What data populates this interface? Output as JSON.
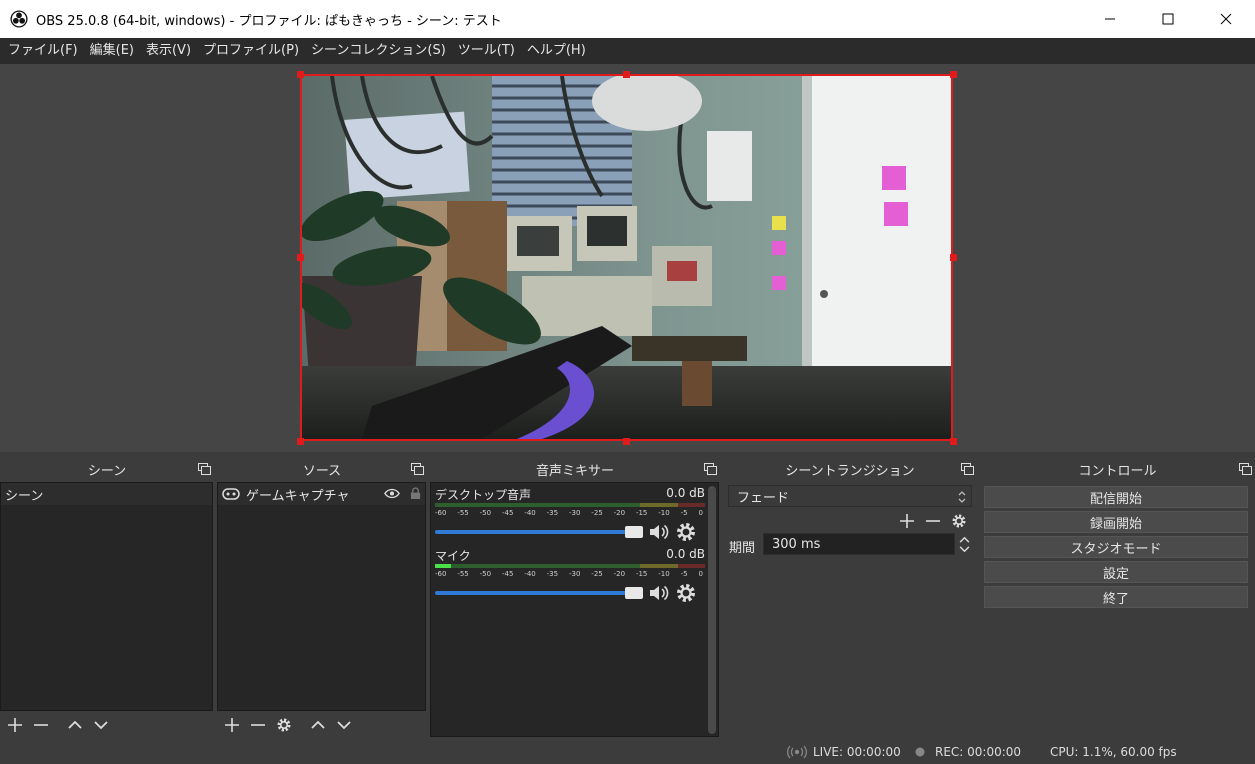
{
  "window": {
    "title": "OBS 25.0.8 (64-bit, windows) - プロファイル: ぱもきゃっち - シーン: テスト"
  },
  "menu": [
    "ファイル(F)",
    "編集(E)",
    "表示(V)",
    "プロファイル(P)",
    "シーンコレクション(S)",
    "ツール(T)",
    "ヘルプ(H)"
  ],
  "docks": {
    "scenes": {
      "title": "シーン",
      "items": [
        "シーン"
      ]
    },
    "sources": {
      "title": "ソース",
      "items": [
        "ゲームキャプチャ"
      ]
    },
    "mixer": {
      "title": "音声ミキサー",
      "ticks": [
        "-60",
        "-55",
        "-50",
        "-45",
        "-40",
        "-35",
        "-30",
        "-25",
        "-20",
        "-15",
        "-10",
        "-5",
        "0"
      ],
      "channels": [
        {
          "name": "デスクトップ音声",
          "db": "0.0 dB",
          "volume": 1.0,
          "level": 0.0
        },
        {
          "name": "マイク",
          "db": "0.0 dB",
          "volume": 1.0,
          "level": 0.06
        }
      ]
    },
    "transitions": {
      "title": "シーントランジション",
      "selected": "フェード",
      "duration_label": "期間",
      "duration_value": "300 ms"
    },
    "controls": {
      "title": "コントロール",
      "buttons": [
        "配信開始",
        "録画開始",
        "スタジオモード",
        "設定",
        "終了"
      ]
    }
  },
  "status": {
    "live": "LIVE: 00:00:00",
    "rec": "REC: 00:00:00",
    "cpu": "CPU: 1.1%, 60.00 fps"
  },
  "colors": {
    "accent": "#2f7ad6",
    "selection": "#e01b1b",
    "meter_green": "#49e049"
  }
}
